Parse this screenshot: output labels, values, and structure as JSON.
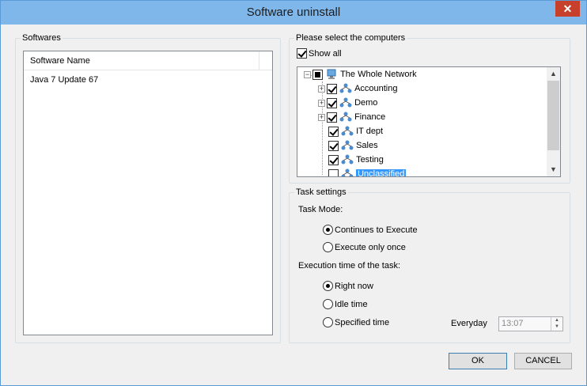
{
  "window": {
    "title": "Software uninstall",
    "close_label": "✕"
  },
  "softwares": {
    "group_label": "Softwares",
    "column_header": "Software Name",
    "items": [
      "Java 7 Update 67"
    ]
  },
  "computers": {
    "group_label": "Please select the computers",
    "show_all_label": "Show all",
    "show_all_checked": true,
    "tree": {
      "root": "The Whole Network",
      "children": [
        "Accounting",
        "Demo",
        "Finance",
        "IT dept",
        "Sales",
        "Testing",
        "Unclassified"
      ]
    }
  },
  "task": {
    "group_label": "Task settings",
    "mode_label": "Task Mode:",
    "mode_options": [
      "Continues to Execute",
      "Execute only once"
    ],
    "mode_selected": 0,
    "time_label": "Execution time of the task:",
    "time_options": [
      "Right now",
      "Idle time",
      "Specified time"
    ],
    "time_selected": 0,
    "everyday_label": "Everyday",
    "time_value": "13:07"
  },
  "buttons": {
    "ok": "OK",
    "cancel": "CANCEL"
  },
  "colors": {
    "titlebar": "#7fb7ea",
    "close": "#c7402c",
    "selection": "#3399ff"
  }
}
